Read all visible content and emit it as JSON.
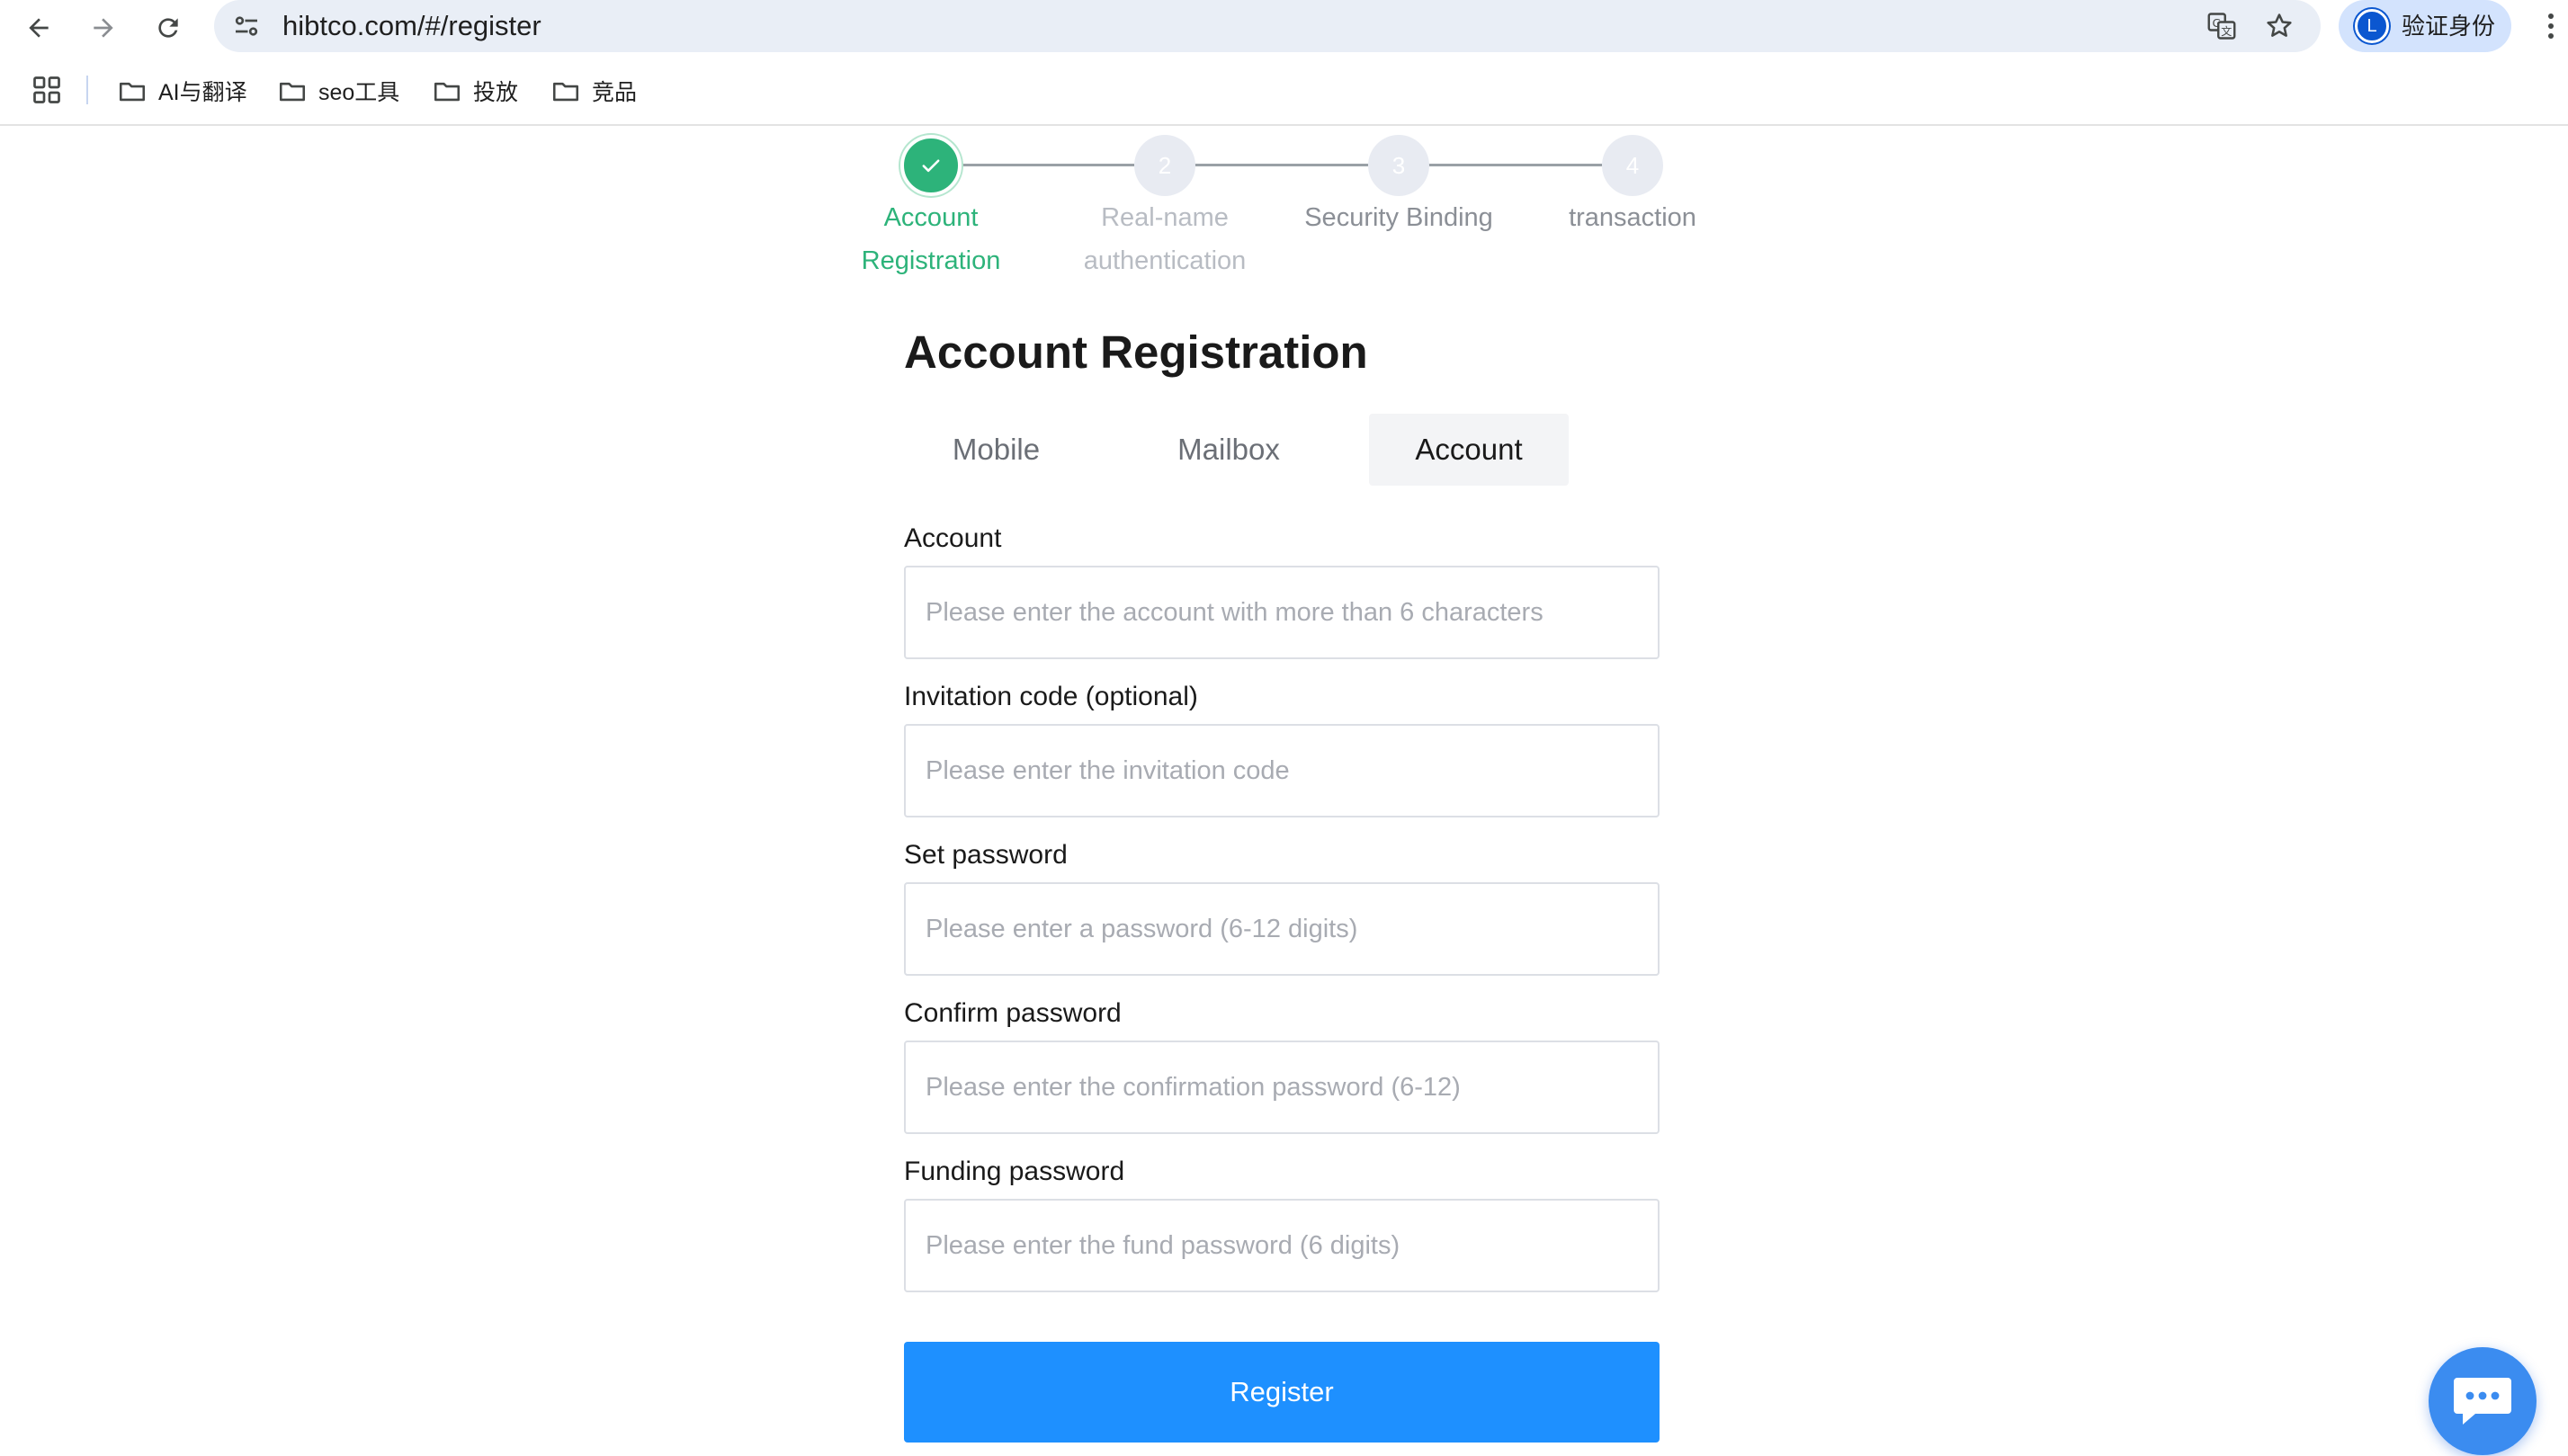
{
  "browser": {
    "url": "hibtco.com/#/register",
    "profile_label": "验证身份",
    "profile_initial": "L",
    "bookmarks": [
      {
        "label": "AI与翻译"
      },
      {
        "label": "seo工具"
      },
      {
        "label": "投放"
      },
      {
        "label": "竞品"
      }
    ]
  },
  "steps": [
    {
      "number": "1",
      "label_line1": "Account",
      "label_line2": "Registration",
      "status": "done"
    },
    {
      "number": "2",
      "label_line1": "Real-name",
      "label_line2": "authentication",
      "status": "todo"
    },
    {
      "number": "3",
      "label_line1": "Security Binding",
      "label_line2": "",
      "status": "todo"
    },
    {
      "number": "4",
      "label_line1": "transaction",
      "label_line2": "",
      "status": "todo"
    }
  ],
  "form": {
    "title": "Account Registration",
    "tabs": [
      {
        "label": "Mobile",
        "active": false
      },
      {
        "label": "Mailbox",
        "active": false
      },
      {
        "label": "Account",
        "active": true
      }
    ],
    "fields": {
      "account": {
        "label": "Account",
        "placeholder": "Please enter the account with more than 6 characters",
        "value": ""
      },
      "invitation": {
        "label": "Invitation code (optional)",
        "placeholder": "Please enter the invitation code",
        "value": ""
      },
      "password": {
        "label": "Set password",
        "placeholder": "Please enter a password (6-12 digits)",
        "value": ""
      },
      "confirm": {
        "label": "Confirm password",
        "placeholder": "Please enter the confirmation password (6-12)",
        "value": ""
      },
      "funding": {
        "label": "Funding password",
        "placeholder": "Please enter the fund password (6 digits)",
        "value": ""
      }
    },
    "submit_label": "Register"
  },
  "colors": {
    "accent_blue": "#1e90ff",
    "step_done_green": "#2db37a",
    "chat_blue": "#3b8cf0"
  },
  "icons": [
    "back-arrow-icon",
    "forward-arrow-icon",
    "reload-icon",
    "site-settings-icon",
    "translate-icon",
    "star-icon",
    "apps-grid-icon",
    "folder-icon",
    "check-icon",
    "chat-icon",
    "menu-dots-icon"
  ]
}
